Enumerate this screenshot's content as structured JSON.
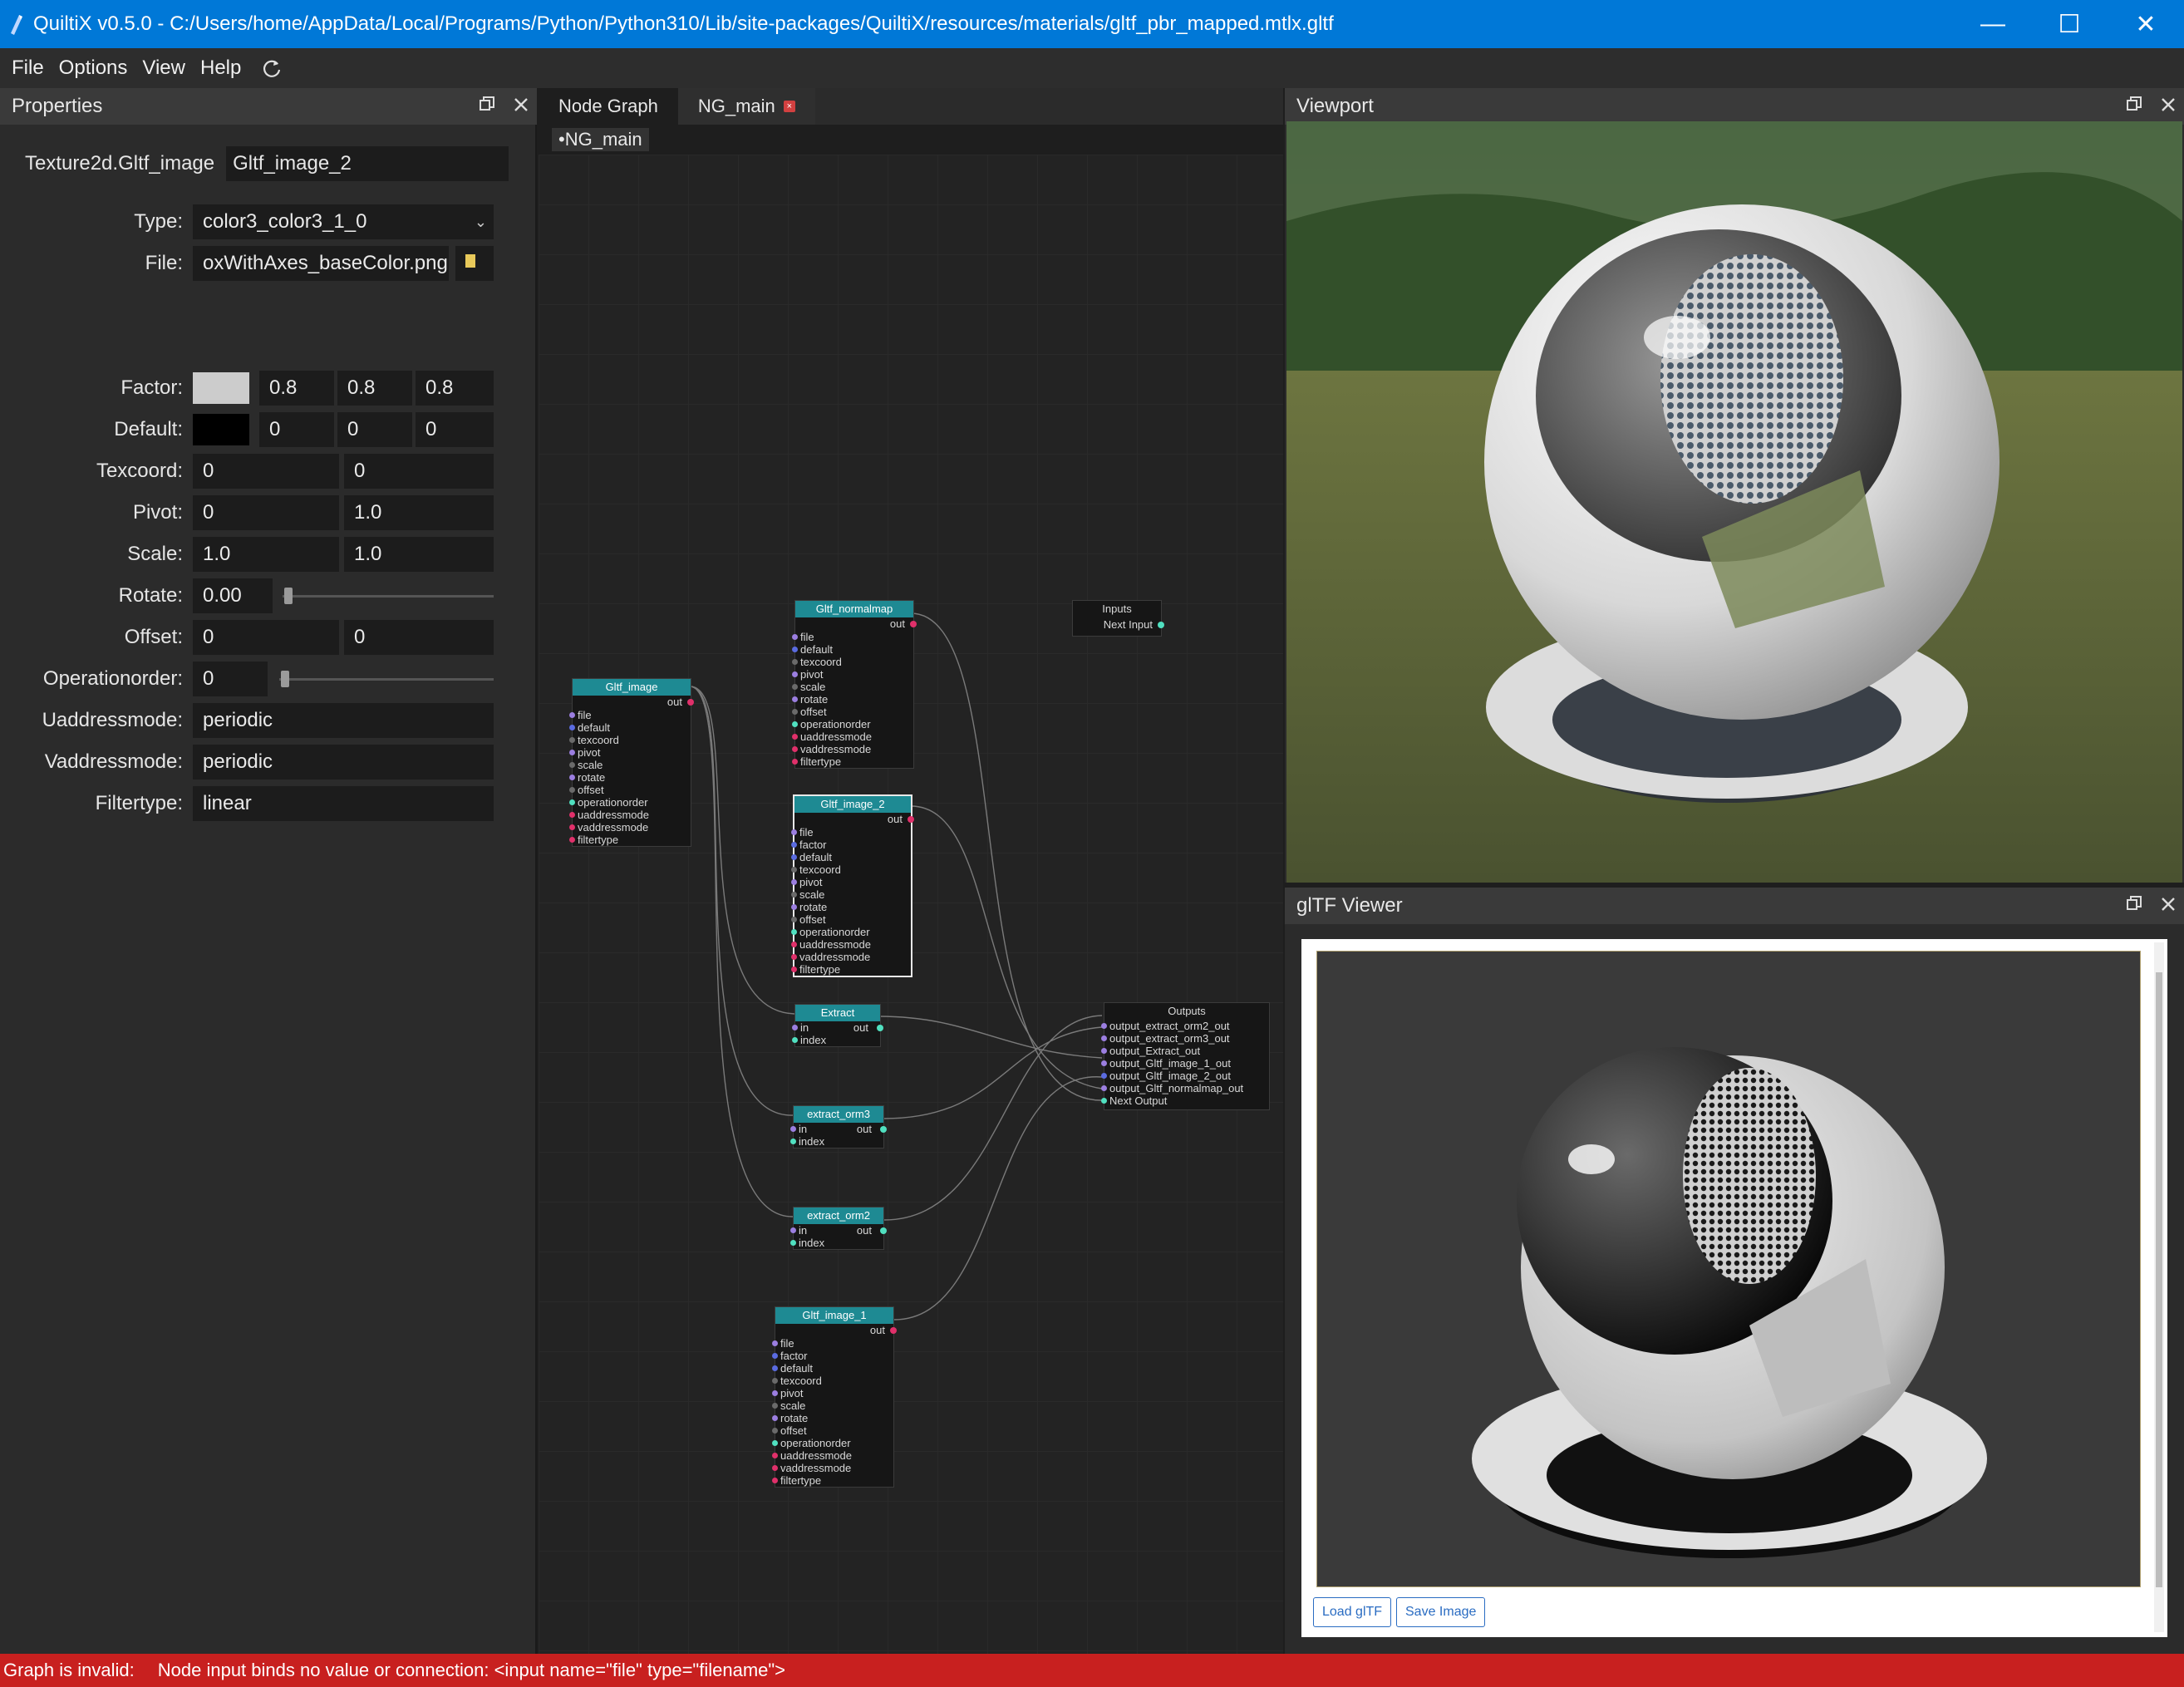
{
  "window": {
    "title": "QuiltiX v0.5.0 - C:/Users/home/AppData/Local/Programs/Python/Python310/Lib/site-packages/QuiltiX/resources/materials/gltf_pbr_mapped.mtlx.gltf",
    "minimize": "—",
    "maximize": "☐",
    "close": "✕"
  },
  "menu": {
    "items": [
      "File",
      "Options",
      "View",
      "Help"
    ]
  },
  "properties": {
    "header": "Properties",
    "node_type": "Texture2d.Gltf_image",
    "node_name": "Gltf_image_2",
    "rows": {
      "type": {
        "label": "Type:",
        "value": "color3_color3_1_0"
      },
      "file": {
        "label": "File:",
        "value": "oxWithAxes_baseColor.png"
      },
      "factor": {
        "label": "Factor:",
        "color": "#cccccc",
        "values": [
          "0.8",
          "0.8",
          "0.8"
        ]
      },
      "default": {
        "label": "Default:",
        "color": "#000000",
        "values": [
          "0",
          "0",
          "0"
        ]
      },
      "texcoord": {
        "label": "Texcoord:",
        "values": [
          "0",
          "0"
        ]
      },
      "pivot": {
        "label": "Pivot:",
        "values": [
          "0",
          "1.0"
        ]
      },
      "scale": {
        "label": "Scale:",
        "values": [
          "1.0",
          "1.0"
        ]
      },
      "rotate": {
        "label": "Rotate:",
        "value": "0.00",
        "slider": 0.0
      },
      "offset": {
        "label": "Offset:",
        "values": [
          "0",
          "0"
        ]
      },
      "operationorder": {
        "label": "Operationorder:",
        "value": "0",
        "slider": 0.0
      },
      "uaddressmode": {
        "label": "Uaddressmode:",
        "value": "periodic"
      },
      "vaddressmode": {
        "label": "Vaddressmode:",
        "value": "periodic"
      },
      "filtertype": {
        "label": "Filtertype:",
        "value": "linear"
      }
    }
  },
  "nodegraph": {
    "tabs": [
      "Node Graph",
      "NG_main"
    ],
    "breadcrumb": "•NG_main",
    "nodes": {
      "gltf_normalmap": {
        "title": "Gltf_normalmap",
        "out": "out",
        "ports": [
          "file",
          "default",
          "texcoord",
          "pivot",
          "scale",
          "rotate",
          "offset",
          "operationorder",
          "uaddressmode",
          "vaddressmode",
          "filtertype"
        ]
      },
      "gltf_image": {
        "title": "Gltf_image",
        "out": "out",
        "ports": [
          "file",
          "default",
          "texcoord",
          "pivot",
          "scale",
          "rotate",
          "offset",
          "operationorder",
          "uaddressmode",
          "vaddressmode",
          "filtertype"
        ]
      },
      "gltf_image_2": {
        "title": "Gltf_image_2",
        "out": "out",
        "ports": [
          "file",
          "factor",
          "default",
          "texcoord",
          "pivot",
          "scale",
          "rotate",
          "offset",
          "operationorder",
          "uaddressmode",
          "vaddressmode",
          "filtertype"
        ]
      },
      "extract": {
        "title": "Extract",
        "out": "out",
        "ports": [
          "in",
          "index"
        ]
      },
      "extract_orm3": {
        "title": "extract_orm3",
        "out": "out",
        "ports": [
          "in",
          "index"
        ]
      },
      "extract_orm2": {
        "title": "extract_orm2",
        "out": "out",
        "ports": [
          "in",
          "index"
        ]
      },
      "gltf_image_1": {
        "title": "Gltf_image_1",
        "out": "out",
        "ports": [
          "file",
          "factor",
          "default",
          "texcoord",
          "pivot",
          "scale",
          "rotate",
          "offset",
          "operationorder",
          "uaddressmode",
          "vaddressmode",
          "filtertype"
        ]
      },
      "inputs": {
        "title": "Inputs",
        "ports": [
          "Next Input"
        ]
      },
      "outputs": {
        "title": "Outputs",
        "ports": [
          "output_extract_orm2_out",
          "output_extract_orm3_out",
          "output_Extract_out",
          "output_Gltf_image_1_out",
          "output_Gltf_image_2_out",
          "output_Gltf_normalmap_out",
          "Next Output"
        ]
      }
    }
  },
  "viewport": {
    "header": "Viewport"
  },
  "gltf_viewer": {
    "header": "glTF Viewer",
    "load_button": "Load glTF",
    "save_button": "Save Image"
  },
  "status": {
    "prefix": "Graph is invalid:",
    "message": "Node input binds no value or connection: <input name=\"file\" type=\"filename\">",
    "color": "#c8201f"
  },
  "colors": {
    "accent": "#0078d7",
    "node_title": "#1e8a93"
  }
}
